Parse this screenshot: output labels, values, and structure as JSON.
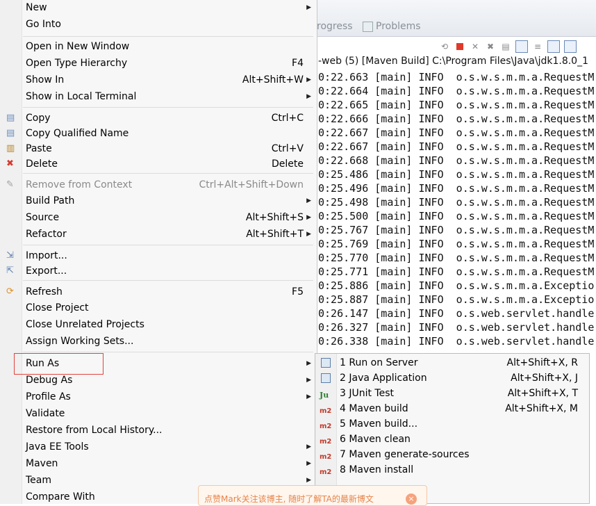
{
  "console": {
    "tabs": [
      {
        "label": "rogress"
      },
      {
        "label": "Problems"
      }
    ],
    "title": "-web (5) [Maven Build] C:\\Program Files\\Java\\jdk1.8.0_1",
    "log_lines": [
      "0:22.663 [main] INFO  o.s.w.s.m.m.a.RequestM",
      "0:22.664 [main] INFO  o.s.w.s.m.m.a.RequestM",
      "0:22.665 [main] INFO  o.s.w.s.m.m.a.RequestM",
      "0:22.666 [main] INFO  o.s.w.s.m.m.a.RequestM",
      "0:22.667 [main] INFO  o.s.w.s.m.m.a.RequestM",
      "0:22.667 [main] INFO  o.s.w.s.m.m.a.RequestM",
      "0:22.668 [main] INFO  o.s.w.s.m.m.a.RequestM",
      "0:25.486 [main] INFO  o.s.w.s.m.m.a.RequestM",
      "0:25.496 [main] INFO  o.s.w.s.m.m.a.RequestM",
      "0:25.498 [main] INFO  o.s.w.s.m.m.a.RequestM",
      "0:25.500 [main] INFO  o.s.w.s.m.m.a.RequestM",
      "0:25.767 [main] INFO  o.s.w.s.m.m.a.RequestM",
      "0:25.769 [main] INFO  o.s.w.s.m.m.a.RequestM",
      "0:25.770 [main] INFO  o.s.w.s.m.m.a.RequestM",
      "0:25.771 [main] INFO  o.s.w.s.m.m.a.RequestM",
      "0:25.886 [main] INFO  o.s.w.s.m.m.a.Exceptio",
      "0:25.887 [main] INFO  o.s.w.s.m.m.a.Exceptio",
      "0:26.147 [main] INFO  o.s.web.servlet.handle",
      "0:26.327 [main] INFO  o.s.web.servlet.handle",
      "0:26.338 [main] INFO  o.s.web.servlet.handle"
    ]
  },
  "menu": {
    "items": [
      {
        "label": "New",
        "shortcut": "",
        "submenu": true
      },
      {
        "label": "Go Into",
        "shortcut": ""
      },
      {
        "label": "Open in New Window",
        "shortcut": ""
      },
      {
        "label": "Open Type Hierarchy",
        "shortcut": "F4"
      },
      {
        "label": "Show In",
        "shortcut": "Alt+Shift+W",
        "submenu": true
      },
      {
        "label": "Show in Local Terminal",
        "shortcut": "",
        "submenu": true
      },
      {
        "label": "Copy",
        "shortcut": "Ctrl+C",
        "icon": "copy-icon"
      },
      {
        "label": "Copy Qualified Name",
        "shortcut": "",
        "icon": "copy-qualified-name-icon"
      },
      {
        "label": "Paste",
        "shortcut": "Ctrl+V",
        "icon": "paste-icon"
      },
      {
        "label": "Delete",
        "shortcut": "Delete",
        "icon": "delete-icon"
      },
      {
        "label": "Remove from Context",
        "shortcut": "Ctrl+Alt+Shift+Down",
        "disabled": true,
        "icon": "remove-context-icon"
      },
      {
        "label": "Build Path",
        "shortcut": "",
        "submenu": true
      },
      {
        "label": "Source",
        "shortcut": "Alt+Shift+S",
        "submenu": true
      },
      {
        "label": "Refactor",
        "shortcut": "Alt+Shift+T",
        "submenu": true
      },
      {
        "label": "Import...",
        "shortcut": "",
        "icon": "import-icon"
      },
      {
        "label": "Export...",
        "shortcut": "",
        "icon": "export-icon"
      },
      {
        "label": "Refresh",
        "shortcut": "F5",
        "icon": "refresh-icon"
      },
      {
        "label": "Close Project",
        "shortcut": ""
      },
      {
        "label": "Close Unrelated Projects",
        "shortcut": ""
      },
      {
        "label": "Assign Working Sets...",
        "shortcut": ""
      },
      {
        "label": "Run As",
        "shortcut": "",
        "submenu": true,
        "highlighted": true
      },
      {
        "label": "Debug As",
        "shortcut": "",
        "submenu": true
      },
      {
        "label": "Profile As",
        "shortcut": "",
        "submenu": true
      },
      {
        "label": "Validate",
        "shortcut": ""
      },
      {
        "label": "Restore from Local History...",
        "shortcut": ""
      },
      {
        "label": "Java EE Tools",
        "shortcut": "",
        "submenu": true
      },
      {
        "label": "Maven",
        "shortcut": "",
        "submenu": true
      },
      {
        "label": "Team",
        "shortcut": "",
        "submenu": true
      },
      {
        "label": "Compare With",
        "shortcut": "",
        "submenu": true
      }
    ]
  },
  "run_as_submenu": {
    "items": [
      {
        "label": "1 Run on Server",
        "shortcut": "Alt+Shift+X, R",
        "icon": "server-icon"
      },
      {
        "label": "2 Java Application",
        "shortcut": "Alt+Shift+X, J",
        "icon": "java-app-icon"
      },
      {
        "label": "3 JUnit Test",
        "shortcut": "Alt+Shift+X, T",
        "icon": "junit-icon",
        "badge": "Ju"
      },
      {
        "label": "4 Maven build",
        "shortcut": "Alt+Shift+X, M",
        "icon": "maven-icon",
        "badge": "m2"
      },
      {
        "label": "5 Maven build...",
        "shortcut": "",
        "icon": "maven-icon",
        "badge": "m2"
      },
      {
        "label": "6 Maven clean",
        "shortcut": "",
        "icon": "maven-icon",
        "badge": "m2"
      },
      {
        "label": "7 Maven generate-sources",
        "shortcut": "",
        "icon": "maven-icon",
        "badge": "m2"
      },
      {
        "label": "8 Maven install",
        "shortcut": "",
        "icon": "maven-icon",
        "badge": "m2"
      }
    ]
  },
  "toast": {
    "text": "点赞Mark关注该博主, 随时了解TA的最新博文",
    "close": "×"
  },
  "colors": {
    "highlight_border": "#e3423b",
    "toast_text": "#e6844a",
    "maven_badge": "#c0392b"
  }
}
